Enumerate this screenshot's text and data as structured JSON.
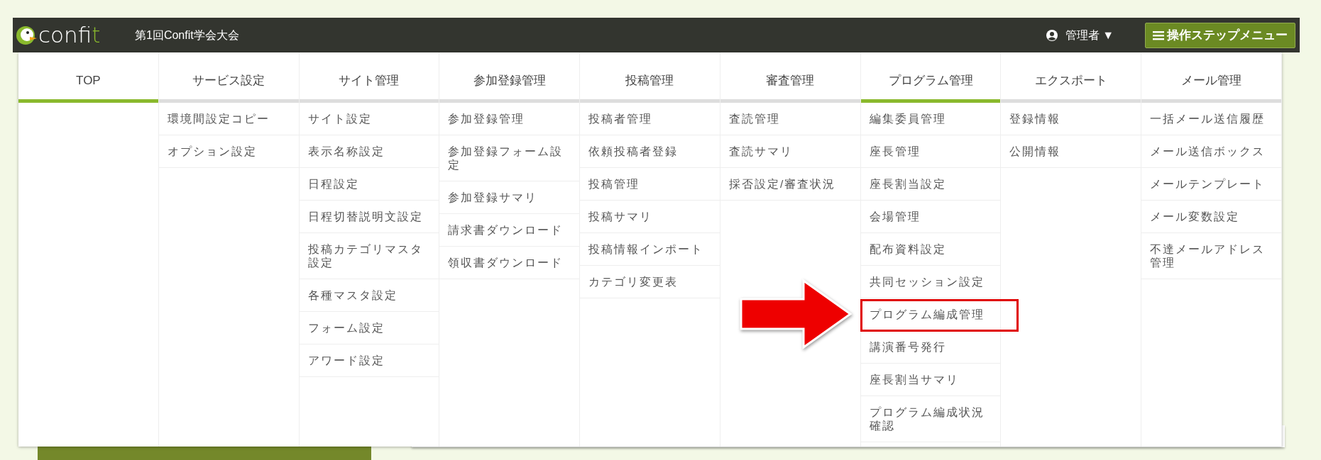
{
  "header": {
    "logo": {
      "text": "conf",
      "accent": "it"
    },
    "title": "第1回Confit学会大会",
    "user": {
      "name": "管理者",
      "caret": "▼"
    },
    "menu_button": "操作ステップメニュー"
  },
  "columns": [
    {
      "label": "TOP",
      "selected": true
    },
    {
      "label": "サービス設定",
      "selected": false,
      "items": [
        {
          "label": "環境間設定コピー",
          "highlighted": false
        },
        {
          "label": "オプション設定",
          "highlighted": false
        }
      ]
    },
    {
      "label": "サイト管理",
      "selected": false,
      "items": [
        {
          "label": "サイト設定",
          "highlighted": false
        },
        {
          "label": "表示名称設定",
          "highlighted": false
        },
        {
          "label": "日程設定",
          "highlighted": false
        },
        {
          "label": "日程切替説明文設定",
          "highlighted": false
        },
        {
          "label": "投稿カテゴリマスタ設定",
          "highlighted": false
        },
        {
          "label": "各種マスタ設定",
          "highlighted": false
        },
        {
          "label": "フォーム設定",
          "highlighted": false
        },
        {
          "label": "アワード設定",
          "highlighted": false
        }
      ]
    },
    {
      "label": "参加登録管理",
      "selected": false,
      "items": [
        {
          "label": "参加登録管理",
          "highlighted": false
        },
        {
          "label": "参加登録フォーム設定",
          "highlighted": false
        },
        {
          "label": "参加登録サマリ",
          "highlighted": false
        },
        {
          "label": "請求書ダウンロード",
          "highlighted": false
        },
        {
          "label": "領収書ダウンロード",
          "highlighted": false
        }
      ]
    },
    {
      "label": "投稿管理",
      "selected": false,
      "items": [
        {
          "label": "投稿者管理",
          "highlighted": false
        },
        {
          "label": "依頼投稿者登録",
          "highlighted": false
        },
        {
          "label": "投稿管理",
          "highlighted": false
        },
        {
          "label": "投稿サマリ",
          "highlighted": false
        },
        {
          "label": "投稿情報インポート",
          "highlighted": false
        },
        {
          "label": "カテゴリ変更表",
          "highlighted": false
        }
      ]
    },
    {
      "label": "審査管理",
      "selected": false,
      "items": [
        {
          "label": "査読管理",
          "highlighted": false
        },
        {
          "label": "査読サマリ",
          "highlighted": false
        },
        {
          "label": "採否設定/審査状況",
          "highlighted": false
        }
      ]
    },
    {
      "label": "プログラム管理",
      "selected": true,
      "items": [
        {
          "label": "編集委員管理",
          "highlighted": false
        },
        {
          "label": "座長管理",
          "highlighted": false
        },
        {
          "label": "座長割当設定",
          "highlighted": false
        },
        {
          "label": "会場管理",
          "highlighted": false
        },
        {
          "label": "配布資料設定",
          "highlighted": false
        },
        {
          "label": "共同セッション設定",
          "highlighted": false
        },
        {
          "label": "プログラム編成管理",
          "highlighted": true
        },
        {
          "label": "講演番号発行",
          "highlighted": false
        },
        {
          "label": "座長割当サマリ",
          "highlighted": false
        },
        {
          "label": "プログラム編成状況確認",
          "highlighted": false
        }
      ]
    },
    {
      "label": "エクスポート",
      "selected": false,
      "items": [
        {
          "label": "登録情報",
          "highlighted": false
        },
        {
          "label": "公開情報",
          "highlighted": false
        }
      ]
    },
    {
      "label": "メール管理",
      "selected": false,
      "items": [
        {
          "label": "一括メール送信履歴",
          "highlighted": false
        },
        {
          "label": "メール送信ボックス",
          "highlighted": false
        },
        {
          "label": "メールテンプレート",
          "highlighted": false
        },
        {
          "label": "メール変数設定",
          "highlighted": false
        },
        {
          "label": "不達メールアドレス管理",
          "highlighted": false
        }
      ]
    }
  ]
}
